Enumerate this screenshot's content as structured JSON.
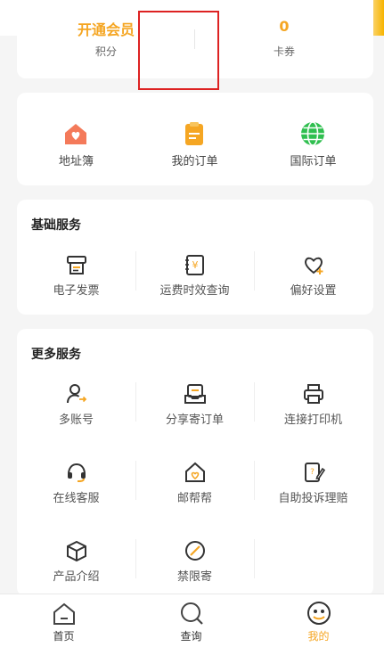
{
  "member": {
    "left_value": "开通会员",
    "left_label": "积分",
    "right_value": "0",
    "right_label": "卡券"
  },
  "quick": [
    {
      "label": "地址簿",
      "icon": "house-icon",
      "color": "#f47a5a"
    },
    {
      "label": "我的订单",
      "icon": "clipboard-icon",
      "color": "#f5a623"
    },
    {
      "label": "国际订单",
      "icon": "globe-icon",
      "color": "#2fbf4f"
    }
  ],
  "basic": {
    "title": "基础服务",
    "items": [
      {
        "label": "电子发票",
        "icon": "printer-receipt-icon"
      },
      {
        "label": "运费时效查询",
        "icon": "yen-document-icon"
      },
      {
        "label": "偏好设置",
        "icon": "heart-plus-icon"
      }
    ]
  },
  "more": {
    "title": "更多服务",
    "items": [
      {
        "label": "多账号",
        "icon": "user-switch-icon"
      },
      {
        "label": "分享寄订单",
        "icon": "share-order-icon"
      },
      {
        "label": "连接打印机",
        "icon": "printer-icon"
      },
      {
        "label": "在线客服",
        "icon": "headset-icon"
      },
      {
        "label": "邮帮帮",
        "icon": "home-heart-icon"
      },
      {
        "label": "自助投诉理赔",
        "icon": "complaint-edit-icon"
      },
      {
        "label": "产品介绍",
        "icon": "box-icon"
      },
      {
        "label": "禁限寄",
        "icon": "forbidden-icon"
      }
    ]
  },
  "tabs": [
    {
      "label": "首页",
      "icon": "home-icon"
    },
    {
      "label": "查询",
      "icon": "search-icon"
    },
    {
      "label": "我的",
      "icon": "profile-icon"
    }
  ],
  "colors": {
    "accent": "#f5a623",
    "highlight_box": "#dd2222"
  }
}
